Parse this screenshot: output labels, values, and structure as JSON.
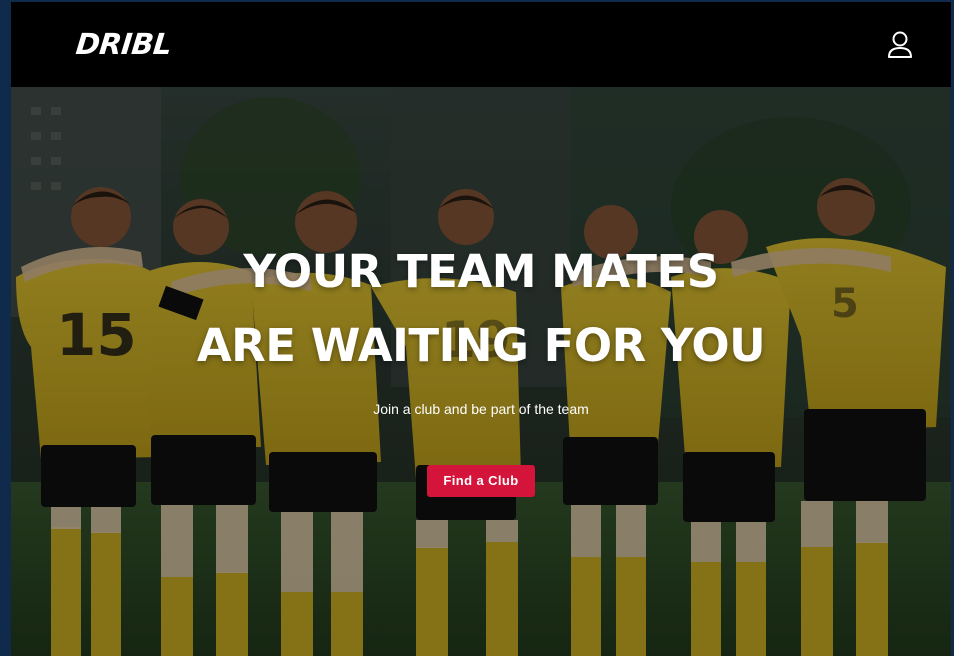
{
  "brand": {
    "logo_text": "DRIBL"
  },
  "header": {
    "user_icon": "user-icon"
  },
  "hero": {
    "headline_line1": "YOUR TEAM MATES",
    "headline_line2": "ARE WAITING FOR YOU",
    "subline": "Join a club and be part of the team",
    "cta_label": "Find a Club",
    "cta_color": "#d4143a",
    "kit_color": "#e3c024",
    "shorts_color": "#0e0e0e",
    "pitch_color": "#2f5a2a"
  }
}
